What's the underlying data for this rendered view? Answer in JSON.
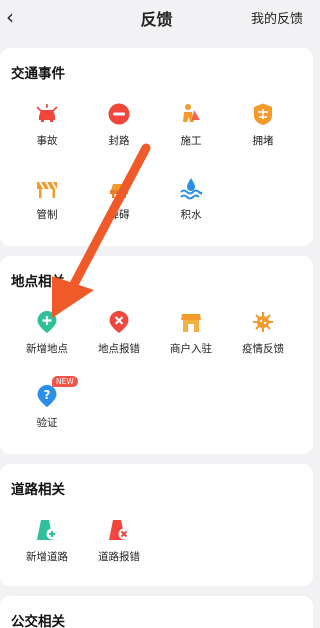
{
  "header": {
    "back_icon": "chevron-left-icon",
    "title": "反馈",
    "my_feedback": "我的反馈"
  },
  "traffic": {
    "title": "交通事件",
    "items": [
      {
        "label": "事故",
        "icon": "accident-icon"
      },
      {
        "label": "封路",
        "icon": "road-closed-icon"
      },
      {
        "label": "施工",
        "icon": "construction-icon"
      },
      {
        "label": "拥堵",
        "icon": "congestion-icon"
      },
      {
        "label": "管制",
        "icon": "control-icon"
      },
      {
        "label": "障碍",
        "icon": "obstacle-icon"
      },
      {
        "label": "积水",
        "icon": "waterlogging-icon"
      }
    ]
  },
  "place": {
    "title": "地点相关",
    "items": [
      {
        "label": "新增地点",
        "icon": "add-place-icon"
      },
      {
        "label": "地点报错",
        "icon": "place-error-icon"
      },
      {
        "label": "商户入驻",
        "icon": "merchant-icon"
      },
      {
        "label": "疫情反馈",
        "icon": "epidemic-icon"
      },
      {
        "label": "验证",
        "icon": "verify-icon",
        "badge": "NEW"
      }
    ]
  },
  "road": {
    "title": "道路相关",
    "items": [
      {
        "label": "新增道路",
        "icon": "add-road-icon"
      },
      {
        "label": "道路报错",
        "icon": "road-error-icon"
      }
    ]
  },
  "bus": {
    "title": "公交相关"
  },
  "colors": {
    "accent_orange": "#f05a28",
    "red": "#f0463c",
    "teal": "#2ec09a",
    "blue": "#2b8ee8"
  }
}
